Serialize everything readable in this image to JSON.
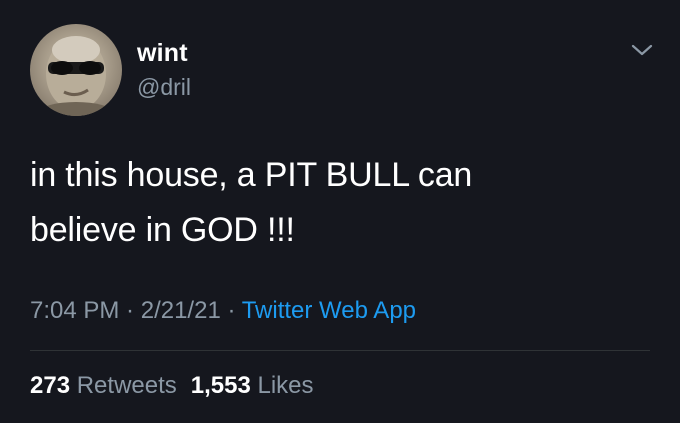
{
  "author": {
    "display_name": "wint",
    "handle": "@dril"
  },
  "tweet": {
    "text_line1": "in this house, a PIT BULL can",
    "text_line2": "believe in GOD !!!",
    "time": "7:04 PM",
    "separator": " · ",
    "date": "2/21/21",
    "source": "Twitter Web App"
  },
  "stats": {
    "retweets_count": "273",
    "retweets_label": "Retweets",
    "likes_count": "1,553",
    "likes_label": "Likes"
  },
  "icons": {
    "menu": "chevron-down-icon"
  },
  "colors": {
    "background": "#15171e",
    "text": "#ffffff",
    "muted": "#8b98a5",
    "link": "#1d9bf0",
    "divider": "#2f3336"
  }
}
